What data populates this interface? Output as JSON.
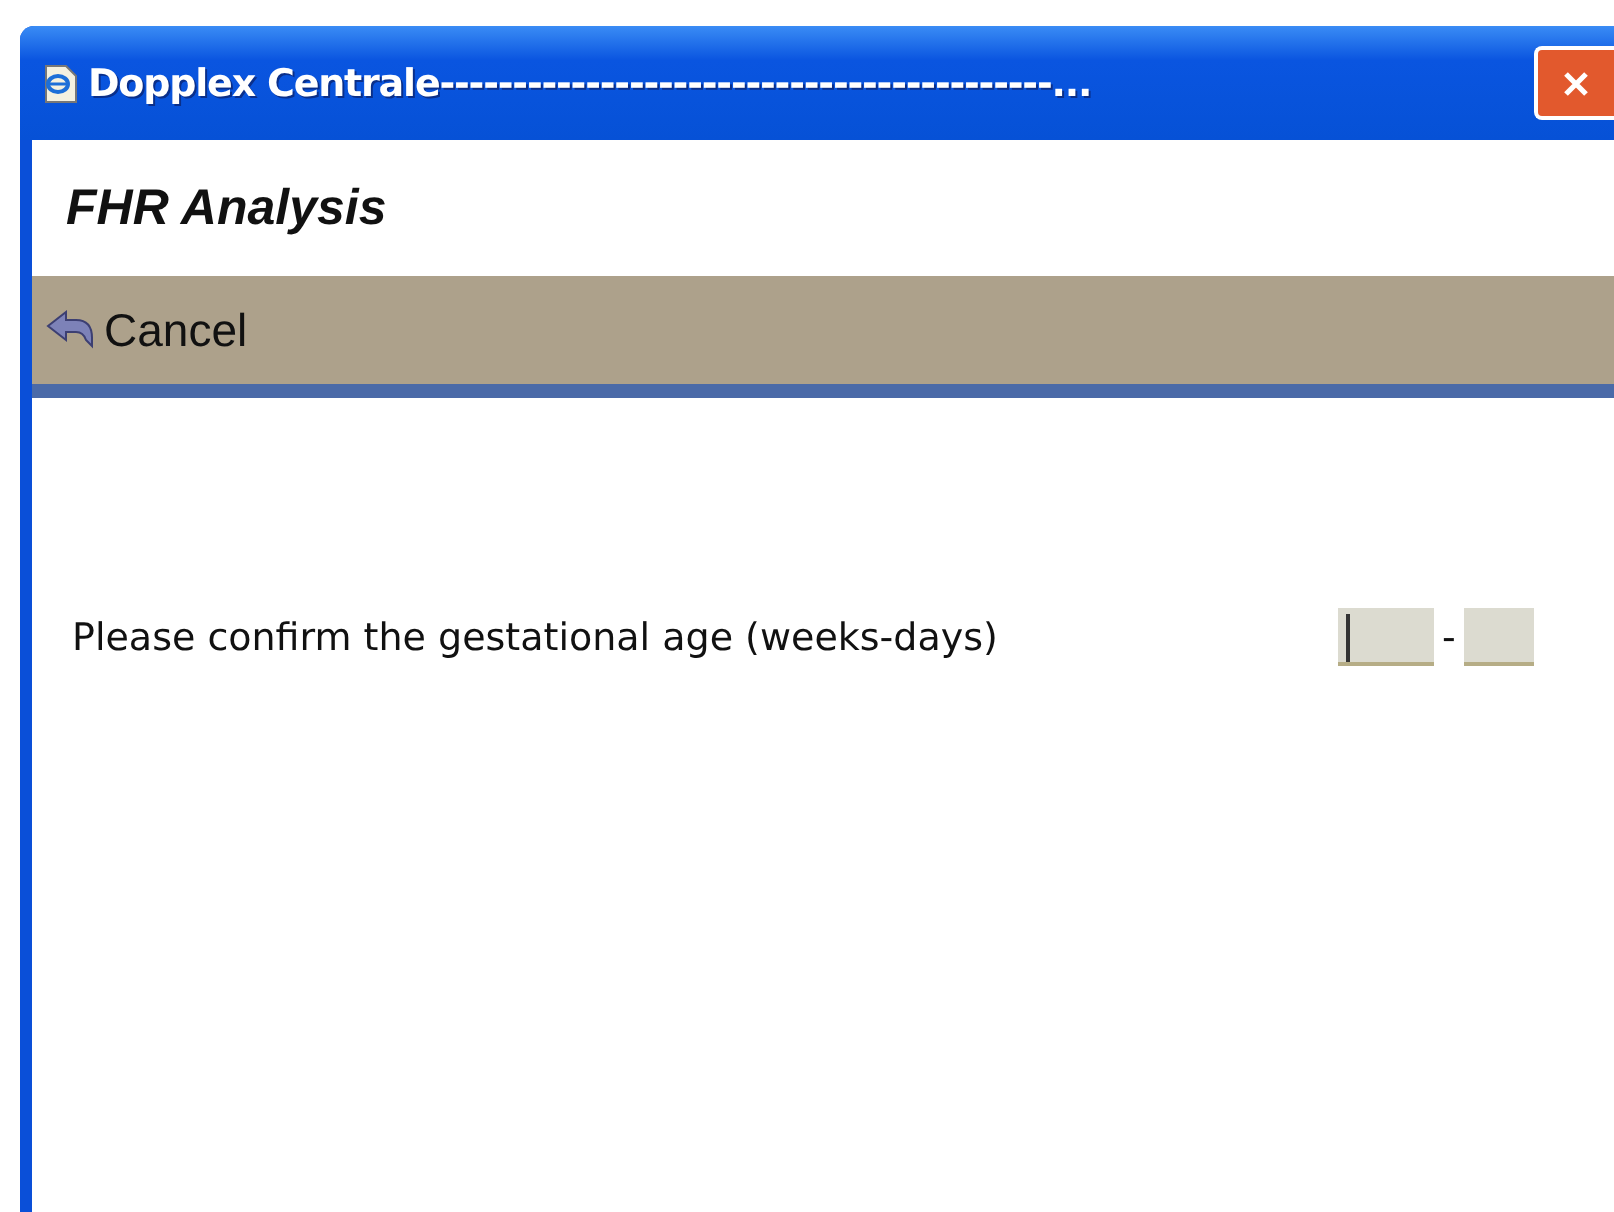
{
  "window": {
    "title": "Dopplex Centrale------------------------------------------..."
  },
  "header": {
    "title": "FHR Analysis"
  },
  "toolbar": {
    "cancel": "Cancel"
  },
  "form": {
    "prompt": "Please confirm the gestational age (weeks-days)",
    "separator": "-",
    "fields": [
      {
        "focused": true
      },
      {
        "focused": false
      }
    ]
  }
}
